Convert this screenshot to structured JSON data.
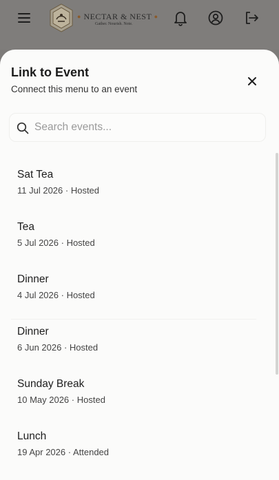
{
  "header": {
    "brand_name": "NECTAR & NEST",
    "brand_tagline": "Gather. Nourish. Note.",
    "icons": [
      "menu-icon",
      "bell-icon",
      "account-icon",
      "logout-icon"
    ]
  },
  "modal": {
    "title": "Link to Event",
    "subtitle": "Connect this menu to an event",
    "search": {
      "placeholder": "Search events...",
      "value": ""
    },
    "events": [
      {
        "name": "Sat Tea",
        "date": "11 Jul 2026",
        "status": "Hosted"
      },
      {
        "name": "Tea",
        "date": "5 Jul 2026",
        "status": "Hosted"
      },
      {
        "name": "Dinner",
        "date": "4 Jul 2026",
        "status": "Hosted"
      },
      {
        "name": "Dinner",
        "date": "6 Jun 2026",
        "status": "Hosted"
      },
      {
        "name": "Sunday Break",
        "date": "10 May 2026",
        "status": "Hosted"
      },
      {
        "name": "Lunch",
        "date": "19 Apr 2026",
        "status": "Attended"
      }
    ]
  },
  "colors": {
    "overlay": "#7d7b79",
    "sheet": "#fbfbfa",
    "brand_accent": "#8a5a2a"
  }
}
